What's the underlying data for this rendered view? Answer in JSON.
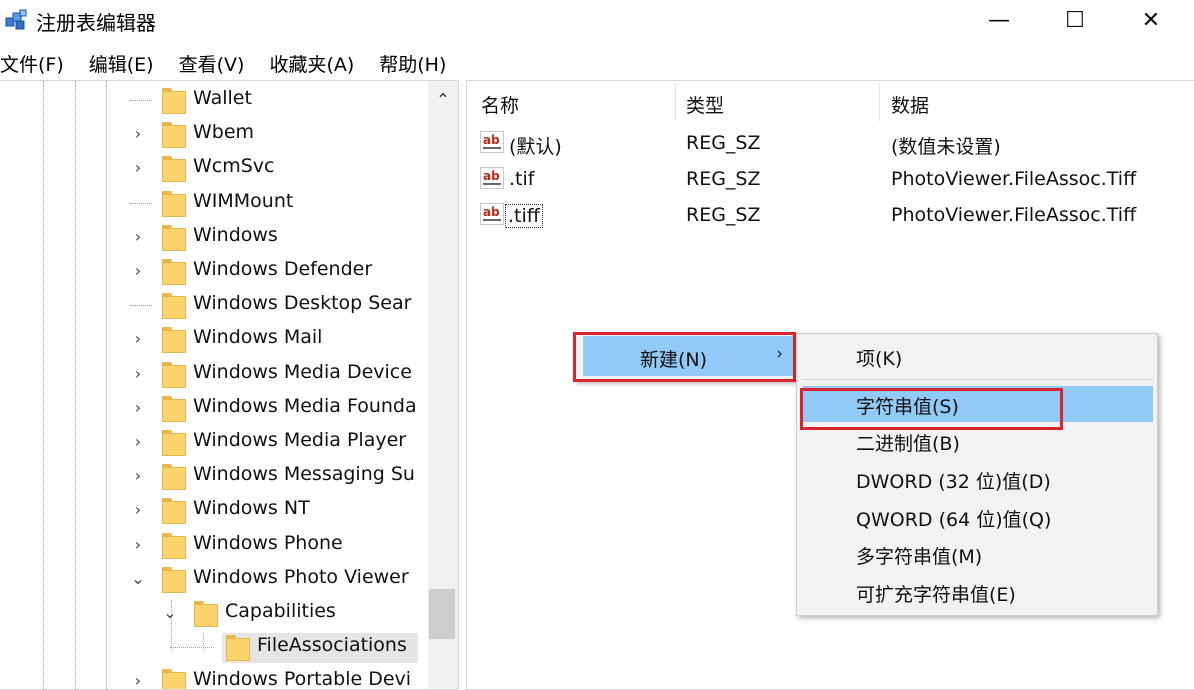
{
  "window": {
    "title": "注册表编辑器",
    "minimize_glyph": "—",
    "maximize_glyph": "☐",
    "close_glyph": "✕"
  },
  "menu": [
    {
      "label": "文件(F)"
    },
    {
      "label": "编辑(E)"
    },
    {
      "label": "查看(V)"
    },
    {
      "label": "收藏夹(A)"
    },
    {
      "label": "帮助(H)"
    }
  ],
  "tree": {
    "items": [
      {
        "label": "Wallet",
        "expander": "none"
      },
      {
        "label": "Wbem",
        "expander": "collapsed"
      },
      {
        "label": "WcmSvc",
        "expander": "collapsed"
      },
      {
        "label": "WIMMount",
        "expander": "none"
      },
      {
        "label": "Windows",
        "expander": "collapsed"
      },
      {
        "label": "Windows Defender",
        "expander": "collapsed"
      },
      {
        "label": "Windows Desktop Sear",
        "expander": "none"
      },
      {
        "label": "Windows Mail",
        "expander": "collapsed"
      },
      {
        "label": "Windows Media Device",
        "expander": "collapsed"
      },
      {
        "label": "Windows Media Founda",
        "expander": "collapsed"
      },
      {
        "label": "Windows Media Player",
        "expander": "collapsed"
      },
      {
        "label": "Windows Messaging Su",
        "expander": "collapsed"
      },
      {
        "label": "Windows NT",
        "expander": "collapsed"
      },
      {
        "label": "Windows Phone",
        "expander": "collapsed"
      },
      {
        "label": "Windows Photo Viewer",
        "expander": "expanded"
      },
      {
        "label": "Capabilities",
        "expander": "expanded"
      },
      {
        "label": "FileAssociations",
        "expander": "none",
        "selected": true
      },
      {
        "label": "Windows Portable Devi",
        "expander": "collapsed"
      }
    ]
  },
  "list": {
    "columns": [
      "名称",
      "类型",
      "数据"
    ],
    "rows": [
      {
        "name": "(默认)",
        "type": "REG_SZ",
        "data": "(数值未设置)"
      },
      {
        "name": ".tif",
        "type": "REG_SZ",
        "data": "PhotoViewer.FileAssoc.Tiff"
      },
      {
        "name": ".tiff",
        "type": "REG_SZ",
        "data": "PhotoViewer.FileAssoc.Tiff",
        "focused": true
      }
    ],
    "value_icon_text": "ab"
  },
  "context_menu": {
    "new_label": "新建(N)",
    "arrow": "›"
  },
  "submenu": {
    "items": [
      {
        "label": "项(K)"
      },
      {
        "label": "字符串值(S)",
        "highlighted": true
      },
      {
        "label": "二进制值(B)"
      },
      {
        "label": "DWORD (32 位)值(D)"
      },
      {
        "label": "QWORD (64 位)值(Q)"
      },
      {
        "label": "多字符串值(M)"
      },
      {
        "label": "可扩充字符串值(E)"
      }
    ]
  },
  "colors": {
    "highlight": "#91c9f7",
    "annotation_red": "#d9252f",
    "folder": "#f9d36b"
  }
}
